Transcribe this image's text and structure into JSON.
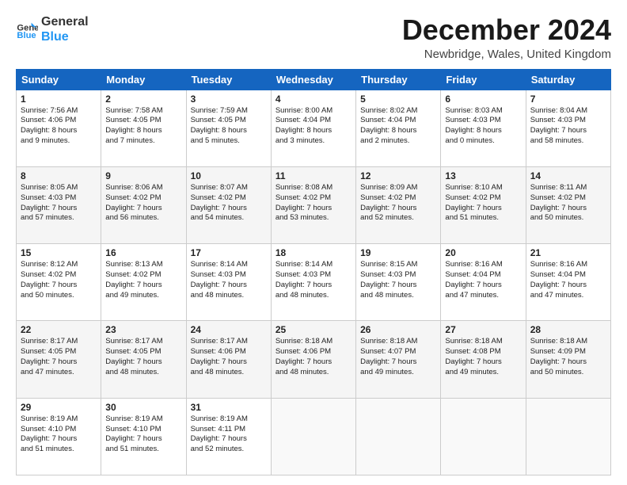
{
  "logo": {
    "line1": "General",
    "line2": "Blue"
  },
  "title": "December 2024",
  "location": "Newbridge, Wales, United Kingdom",
  "headers": [
    "Sunday",
    "Monday",
    "Tuesday",
    "Wednesday",
    "Thursday",
    "Friday",
    "Saturday"
  ],
  "weeks": [
    [
      {
        "day": "1",
        "info": "Sunrise: 7:56 AM\nSunset: 4:06 PM\nDaylight: 8 hours\nand 9 minutes."
      },
      {
        "day": "2",
        "info": "Sunrise: 7:58 AM\nSunset: 4:05 PM\nDaylight: 8 hours\nand 7 minutes."
      },
      {
        "day": "3",
        "info": "Sunrise: 7:59 AM\nSunset: 4:05 PM\nDaylight: 8 hours\nand 5 minutes."
      },
      {
        "day": "4",
        "info": "Sunrise: 8:00 AM\nSunset: 4:04 PM\nDaylight: 8 hours\nand 3 minutes."
      },
      {
        "day": "5",
        "info": "Sunrise: 8:02 AM\nSunset: 4:04 PM\nDaylight: 8 hours\nand 2 minutes."
      },
      {
        "day": "6",
        "info": "Sunrise: 8:03 AM\nSunset: 4:03 PM\nDaylight: 8 hours\nand 0 minutes."
      },
      {
        "day": "7",
        "info": "Sunrise: 8:04 AM\nSunset: 4:03 PM\nDaylight: 7 hours\nand 58 minutes."
      }
    ],
    [
      {
        "day": "8",
        "info": "Sunrise: 8:05 AM\nSunset: 4:03 PM\nDaylight: 7 hours\nand 57 minutes."
      },
      {
        "day": "9",
        "info": "Sunrise: 8:06 AM\nSunset: 4:02 PM\nDaylight: 7 hours\nand 56 minutes."
      },
      {
        "day": "10",
        "info": "Sunrise: 8:07 AM\nSunset: 4:02 PM\nDaylight: 7 hours\nand 54 minutes."
      },
      {
        "day": "11",
        "info": "Sunrise: 8:08 AM\nSunset: 4:02 PM\nDaylight: 7 hours\nand 53 minutes."
      },
      {
        "day": "12",
        "info": "Sunrise: 8:09 AM\nSunset: 4:02 PM\nDaylight: 7 hours\nand 52 minutes."
      },
      {
        "day": "13",
        "info": "Sunrise: 8:10 AM\nSunset: 4:02 PM\nDaylight: 7 hours\nand 51 minutes."
      },
      {
        "day": "14",
        "info": "Sunrise: 8:11 AM\nSunset: 4:02 PM\nDaylight: 7 hours\nand 50 minutes."
      }
    ],
    [
      {
        "day": "15",
        "info": "Sunrise: 8:12 AM\nSunset: 4:02 PM\nDaylight: 7 hours\nand 50 minutes."
      },
      {
        "day": "16",
        "info": "Sunrise: 8:13 AM\nSunset: 4:02 PM\nDaylight: 7 hours\nand 49 minutes."
      },
      {
        "day": "17",
        "info": "Sunrise: 8:14 AM\nSunset: 4:03 PM\nDaylight: 7 hours\nand 48 minutes."
      },
      {
        "day": "18",
        "info": "Sunrise: 8:14 AM\nSunset: 4:03 PM\nDaylight: 7 hours\nand 48 minutes."
      },
      {
        "day": "19",
        "info": "Sunrise: 8:15 AM\nSunset: 4:03 PM\nDaylight: 7 hours\nand 48 minutes."
      },
      {
        "day": "20",
        "info": "Sunrise: 8:16 AM\nSunset: 4:04 PM\nDaylight: 7 hours\nand 47 minutes."
      },
      {
        "day": "21",
        "info": "Sunrise: 8:16 AM\nSunset: 4:04 PM\nDaylight: 7 hours\nand 47 minutes."
      }
    ],
    [
      {
        "day": "22",
        "info": "Sunrise: 8:17 AM\nSunset: 4:05 PM\nDaylight: 7 hours\nand 47 minutes."
      },
      {
        "day": "23",
        "info": "Sunrise: 8:17 AM\nSunset: 4:05 PM\nDaylight: 7 hours\nand 48 minutes."
      },
      {
        "day": "24",
        "info": "Sunrise: 8:17 AM\nSunset: 4:06 PM\nDaylight: 7 hours\nand 48 minutes."
      },
      {
        "day": "25",
        "info": "Sunrise: 8:18 AM\nSunset: 4:06 PM\nDaylight: 7 hours\nand 48 minutes."
      },
      {
        "day": "26",
        "info": "Sunrise: 8:18 AM\nSunset: 4:07 PM\nDaylight: 7 hours\nand 49 minutes."
      },
      {
        "day": "27",
        "info": "Sunrise: 8:18 AM\nSunset: 4:08 PM\nDaylight: 7 hours\nand 49 minutes."
      },
      {
        "day": "28",
        "info": "Sunrise: 8:18 AM\nSunset: 4:09 PM\nDaylight: 7 hours\nand 50 minutes."
      }
    ],
    [
      {
        "day": "29",
        "info": "Sunrise: 8:19 AM\nSunset: 4:10 PM\nDaylight: 7 hours\nand 51 minutes."
      },
      {
        "day": "30",
        "info": "Sunrise: 8:19 AM\nSunset: 4:10 PM\nDaylight: 7 hours\nand 51 minutes."
      },
      {
        "day": "31",
        "info": "Sunrise: 8:19 AM\nSunset: 4:11 PM\nDaylight: 7 hours\nand 52 minutes."
      },
      {
        "day": "",
        "info": ""
      },
      {
        "day": "",
        "info": ""
      },
      {
        "day": "",
        "info": ""
      },
      {
        "day": "",
        "info": ""
      }
    ]
  ]
}
